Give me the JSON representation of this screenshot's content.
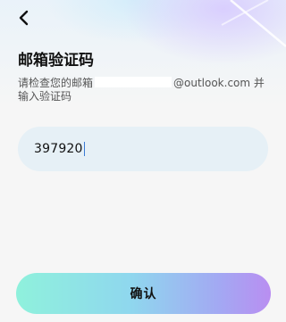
{
  "header": {
    "back_icon": "chevron-left-icon"
  },
  "page": {
    "title": "邮箱验证码",
    "instruction_prefix": "请检查您的邮箱",
    "email_domain": "@outlook.com",
    "instruction_suffix_1": " 并",
    "instruction_line2": "输入验证码"
  },
  "code_input": {
    "value": "397920"
  },
  "confirm": {
    "label": "确认"
  },
  "colors": {
    "background": "#f6f6f6",
    "field_bg": "#e6f0f6",
    "button_gradient_start": "#8ff1dc",
    "button_gradient_end": "#b98ef1"
  }
}
